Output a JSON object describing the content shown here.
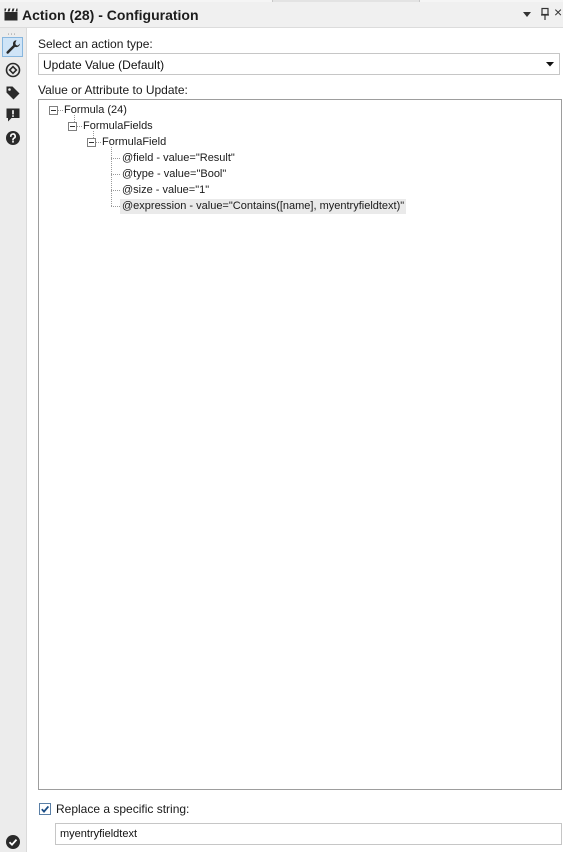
{
  "window": {
    "title": "Action (28) - Configuration",
    "controls": {
      "dropdown_icon": "caret-down-icon",
      "pin_icon": "pin-icon",
      "close_label": "×"
    }
  },
  "sidebar": {
    "items": [
      {
        "name": "configuration",
        "icon": "wrench-icon",
        "active": true
      },
      {
        "name": "layout",
        "icon": "layout-icon",
        "active": false
      },
      {
        "name": "annotation",
        "icon": "tag-icon",
        "active": false
      },
      {
        "name": "errors",
        "icon": "alert-icon",
        "active": false
      },
      {
        "name": "help",
        "icon": "help-icon",
        "active": false
      }
    ],
    "status_icon": "check-circle-icon"
  },
  "action_type": {
    "label": "Select an action type:",
    "selected": "Update Value (Default)"
  },
  "tree": {
    "label": "Value or Attribute to Update:",
    "nodes": [
      {
        "text": "Formula (24)",
        "level": 0,
        "expanded": true
      },
      {
        "text": "FormulaFields",
        "level": 1,
        "expanded": true
      },
      {
        "text": "FormulaField",
        "level": 2,
        "expanded": true
      },
      {
        "text": "@field - value=\"Result\"",
        "level": 3
      },
      {
        "text": "@type - value=\"Bool\"",
        "level": 3
      },
      {
        "text": "@size - value=\"1\"",
        "level": 3
      },
      {
        "text": "@expression - value=\"Contains([name], myentryfieldtext)\"",
        "level": 3,
        "selected": true
      }
    ]
  },
  "replace": {
    "label": "Replace a specific string:",
    "checked": true,
    "value": "myentryfieldtext"
  },
  "colors": {
    "accent": "#2f6fb3",
    "selection": "#eaeaea",
    "check": "#1a4d86"
  }
}
